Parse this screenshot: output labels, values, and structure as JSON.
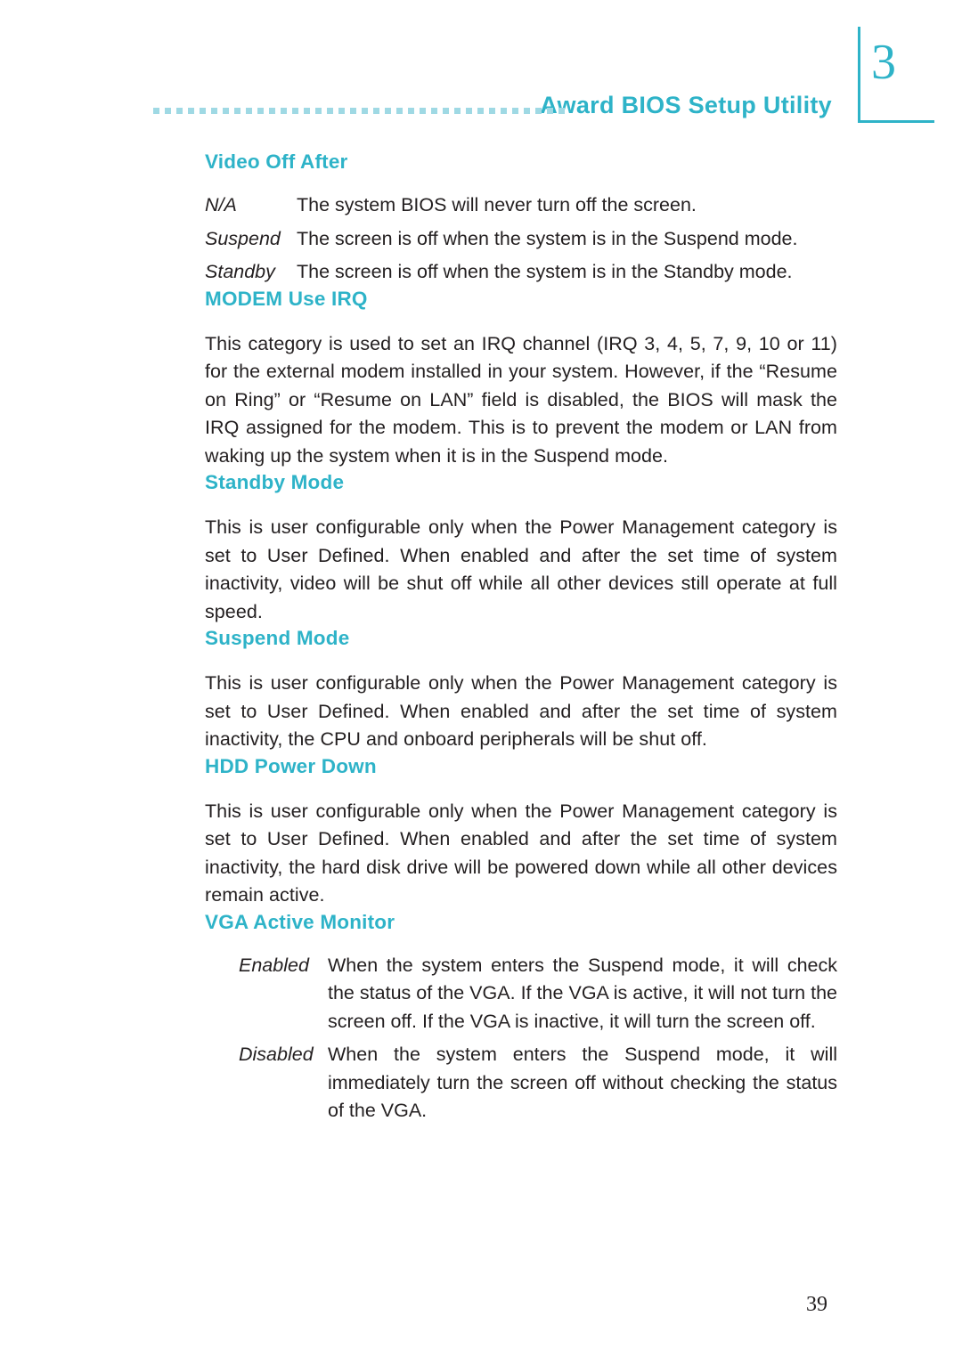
{
  "header": {
    "chapter_number": "3",
    "title": "Award BIOS Setup Utility",
    "dot_count": 36,
    "accent_color": "#2eb3c8"
  },
  "page_number": "39",
  "sections": [
    {
      "heading": "Video Off After",
      "definitions": [
        {
          "term": "N/A",
          "desc": "The system BIOS will never turn off the screen."
        },
        {
          "term": "Suspend",
          "desc": "The screen is off when the system is in the Suspend mode."
        },
        {
          "term": "Standby",
          "desc": "The screen is off when the system is in the Standby mode."
        }
      ]
    },
    {
      "heading": "MODEM Use IRQ",
      "paragraph": "This category is used to set an IRQ channel (IRQ 3, 4, 5, 7, 9, 10 or 11) for the external modem installed in your system. However, if the “Resume on Ring” or “Resume on LAN” field is disabled, the BIOS will mask the IRQ assigned for the modem. This is to prevent the modem or LAN from waking up the system when it is in the Suspend mode."
    },
    {
      "heading": "Standby Mode",
      "paragraph": "This is user configurable only when the Power Management category is set to User Defined. When enabled and after the set time of system inactivity, video will be shut off while all other devices still operate at full speed."
    },
    {
      "heading": "Suspend Mode",
      "paragraph": "This is user configurable only when the Power Management category is set to User Defined. When enabled and after the set time of system inactivity, the CPU and onboard peripherals will be shut off."
    },
    {
      "heading": "HDD Power Down",
      "paragraph": "This is user configurable only when the Power Management category is set to User Defined. When enabled and after the set time of system inactivity, the hard disk drive will be powered down while all other devices remain active."
    },
    {
      "heading": "VGA Active Monitor",
      "definitions": [
        {
          "term": "Enabled",
          "desc": "When the system enters the Suspend mode, it will check the status of the VGA. If the VGA is active, it will not turn the screen off. If the VGA is inactive, it will turn the screen off."
        },
        {
          "term": "Disabled",
          "desc": "When the system enters the Suspend mode, it will immediately turn the screen off without checking the status of the VGA."
        }
      ]
    }
  ]
}
